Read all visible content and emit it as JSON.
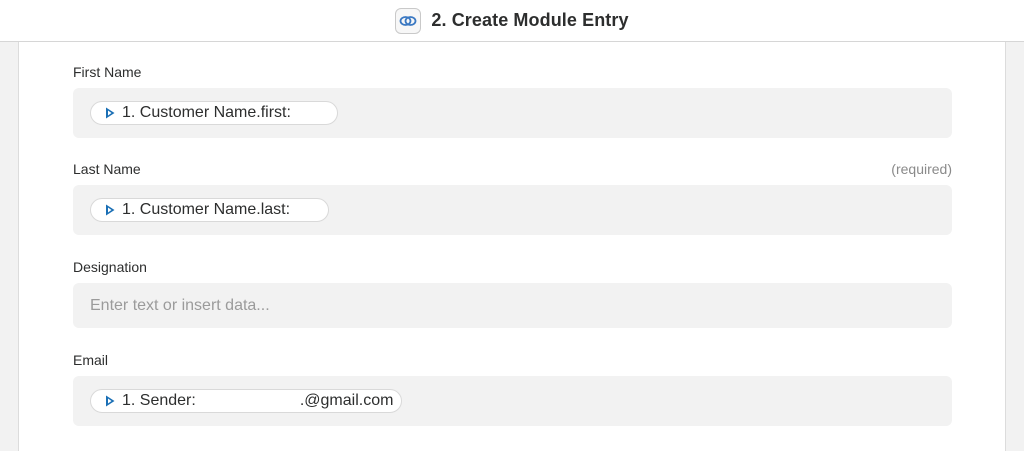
{
  "header": {
    "title": "2. Create Module Entry",
    "app_icon": "link-rings-icon"
  },
  "fields": {
    "first_name": {
      "label": "First Name",
      "token_text": "1. Customer Name.first:"
    },
    "last_name": {
      "label": "Last Name",
      "required": "(required)",
      "token_text": "1. Customer Name.last:"
    },
    "designation": {
      "label": "Designation",
      "placeholder": "Enter text or insert data..."
    },
    "email": {
      "label": "Email",
      "token_text": "1. Sender:",
      "token_suffix": ".@gmail.com"
    }
  },
  "colors": {
    "accent": "#1a6fb5",
    "field_bg": "#f2f2f2"
  }
}
